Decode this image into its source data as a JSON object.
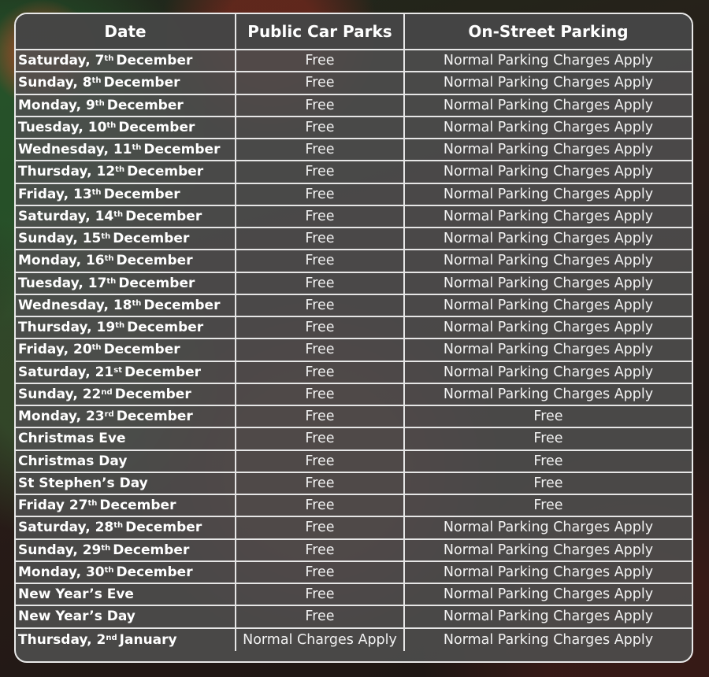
{
  "table": {
    "headers": [
      "Date",
      "Public Car Parks",
      "On-Street Parking"
    ],
    "rows": [
      {
        "day": "Saturday, 7",
        "ord": "th",
        "rest": "December",
        "car_parks": "Free",
        "on_street": "Normal Parking Charges Apply"
      },
      {
        "day": "Sunday, 8",
        "ord": "th",
        "rest": "December",
        "car_parks": "Free",
        "on_street": "Normal Parking Charges Apply"
      },
      {
        "day": "Monday, 9",
        "ord": "th",
        "rest": "December",
        "car_parks": "Free",
        "on_street": "Normal Parking Charges Apply"
      },
      {
        "day": "Tuesday, 10",
        "ord": "th",
        "rest": "December",
        "car_parks": "Free",
        "on_street": "Normal Parking Charges Apply"
      },
      {
        "day": "Wednesday, 11",
        "ord": "th",
        "rest": "December",
        "car_parks": "Free",
        "on_street": "Normal Parking Charges Apply"
      },
      {
        "day": "Thursday, 12",
        "ord": "th",
        "rest": "December",
        "car_parks": "Free",
        "on_street": "Normal Parking Charges Apply"
      },
      {
        "day": "Friday, 13",
        "ord": "th",
        "rest": "December",
        "car_parks": "Free",
        "on_street": "Normal Parking Charges Apply"
      },
      {
        "day": "Saturday, 14",
        "ord": "th",
        "rest": "December",
        "car_parks": "Free",
        "on_street": "Normal Parking Charges Apply"
      },
      {
        "day": "Sunday, 15",
        "ord": "th",
        "rest": "December",
        "car_parks": "Free",
        "on_street": "Normal Parking Charges Apply"
      },
      {
        "day": "Monday, 16",
        "ord": "th",
        "rest": "December",
        "car_parks": "Free",
        "on_street": "Normal Parking Charges Apply"
      },
      {
        "day": "Tuesday, 17",
        "ord": "th",
        "rest": "December",
        "car_parks": "Free",
        "on_street": "Normal Parking Charges Apply"
      },
      {
        "day": "Wednesday, 18",
        "ord": "th",
        "rest": "December",
        "car_parks": "Free",
        "on_street": "Normal Parking Charges Apply"
      },
      {
        "day": "Thursday, 19",
        "ord": "th",
        "rest": "December",
        "car_parks": "Free",
        "on_street": "Normal Parking Charges Apply"
      },
      {
        "day": "Friday, 20",
        "ord": "th",
        "rest": "December",
        "car_parks": "Free",
        "on_street": "Normal Parking Charges Apply"
      },
      {
        "day": "Saturday, 21",
        "ord": "st",
        "rest": "December",
        "car_parks": "Free",
        "on_street": "Normal Parking Charges Apply"
      },
      {
        "day": "Sunday, 22",
        "ord": "nd",
        "rest": "December",
        "car_parks": "Free",
        "on_street": "Normal Parking Charges Apply"
      },
      {
        "day": "Monday, 23",
        "ord": "rd",
        "rest": "December",
        "car_parks": "Free",
        "on_street": "Free"
      },
      {
        "day": "Christmas Eve",
        "ord": "",
        "rest": "",
        "car_parks": "Free",
        "on_street": "Free"
      },
      {
        "day": "Christmas Day",
        "ord": "",
        "rest": "",
        "car_parks": "Free",
        "on_street": "Free"
      },
      {
        "day": "St Stephen’s Day",
        "ord": "",
        "rest": "",
        "car_parks": "Free",
        "on_street": "Free"
      },
      {
        "day": "Friday 27",
        "ord": "th",
        "rest": "December",
        "car_parks": "Free",
        "on_street": "Free"
      },
      {
        "day": "Saturday, 28",
        "ord": "th",
        "rest": "December",
        "car_parks": "Free",
        "on_street": "Normal Parking Charges Apply"
      },
      {
        "day": "Sunday, 29",
        "ord": "th",
        "rest": "December",
        "car_parks": "Free",
        "on_street": "Normal Parking Charges Apply"
      },
      {
        "day": "Monday, 30",
        "ord": "th",
        "rest": "December",
        "car_parks": "Free",
        "on_street": "Normal Parking Charges Apply"
      },
      {
        "day": "New Year’s Eve",
        "ord": "",
        "rest": "",
        "car_parks": "Free",
        "on_street": "Normal Parking Charges Apply"
      },
      {
        "day": "New Year’s Day",
        "ord": "",
        "rest": "",
        "car_parks": "Free",
        "on_street": "Normal Parking Charges Apply"
      },
      {
        "day": "Thursday, 2",
        "ord": "nd",
        "rest": "January",
        "car_parks": "Normal Charges Apply",
        "on_street": "Normal Parking Charges Apply"
      }
    ]
  }
}
